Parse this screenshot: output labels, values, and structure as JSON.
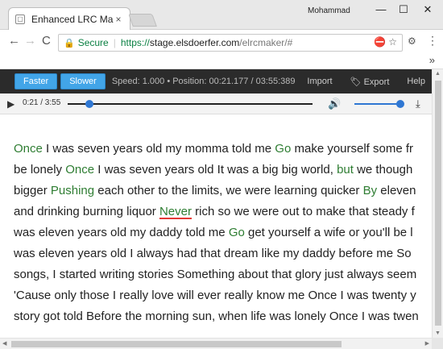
{
  "browser": {
    "tab_title": "Enhanced LRC Maker",
    "tab_close": "×",
    "profile_name": "Mohammad",
    "window_buttons": {
      "minimize": "—",
      "maximize": "☐",
      "close": "✕"
    },
    "nav": {
      "back": "←",
      "forward": "→",
      "reload": "C"
    },
    "address": {
      "secure_label": "Secure",
      "separator": "|",
      "scheme": "https://",
      "host": "stage.elsdoerfer.com",
      "path": "/elrcmaker/#"
    },
    "bookmarks_overflow": "»",
    "menu_glyph": "⋮"
  },
  "app": {
    "buttons": {
      "faster": "Faster",
      "slower": "Slower"
    },
    "status": "Speed: 1.000 • Position: 00:21.177 / 03:55:389",
    "menu": {
      "import": "Import",
      "export": "Export",
      "help": "Help"
    },
    "player": {
      "time": "0:21 / 3:55",
      "progress_fraction": 0.09,
      "volume_fraction": 1.0
    },
    "lyrics": [
      [
        {
          "t": "Once",
          "k": true
        },
        {
          "t": " I was seven years old my momma told me "
        },
        {
          "t": "Go",
          "k": true
        },
        {
          "t": " make yourself some fr"
        }
      ],
      [
        {
          "t": "be lonely "
        },
        {
          "t": "Once",
          "k": true
        },
        {
          "t": " I was seven years old It was a big big world, "
        },
        {
          "t": "but",
          "k": true
        },
        {
          "t": " we though"
        }
      ],
      [
        {
          "t": "bigger "
        },
        {
          "t": "Pushing",
          "k": true
        },
        {
          "t": " each other to the limits, we were learning quicker "
        },
        {
          "t": "By",
          "k": true
        },
        {
          "t": " eleven"
        }
      ],
      [
        {
          "t": "and drinking burning liquor "
        },
        {
          "t": "Never",
          "k": true,
          "a": true
        },
        {
          "t": " rich so we were out to make that steady f"
        }
      ],
      [
        {
          "t": "was eleven years old my daddy told me "
        },
        {
          "t": "Go",
          "k": true
        },
        {
          "t": " get yourself a wife or you'll be l"
        }
      ],
      [
        {
          "t": "was eleven years old I always had that dream like my daddy before me So"
        }
      ],
      [
        {
          "t": "songs, I started writing stories Something about that glory just always seem"
        }
      ],
      [
        {
          "t": "'Cause only those I really love will ever really know me Once I was twenty y"
        }
      ],
      [
        {
          "t": "story got told Before the morning sun, when life was lonely Once I was twen"
        }
      ]
    ]
  },
  "colors": {
    "app_bar": "#2b2b2b",
    "button": "#42a5e8",
    "keyword": "#2e7d32",
    "active_underline": "#e53935",
    "slider": "#2f77d3"
  }
}
